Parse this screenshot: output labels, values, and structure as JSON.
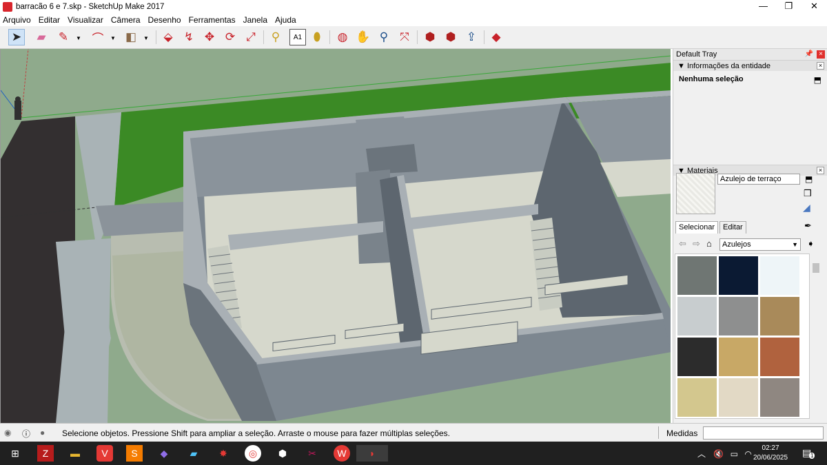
{
  "window": {
    "title": "barracão 6 e 7.skp - SketchUp Make 2017",
    "minimize": "—",
    "restore": "❐",
    "close": "✕"
  },
  "menu": [
    "Arquivo",
    "Editar",
    "Visualizar",
    "Câmera",
    "Desenho",
    "Ferramentas",
    "Janela",
    "Ajuda"
  ],
  "toolbar": {
    "tools": [
      {
        "name": "select-tool",
        "glyph": "➤",
        "selected": true
      },
      {
        "name": "eraser-tool",
        "glyph": "▰"
      },
      {
        "name": "pencil-tool",
        "glyph": "✎"
      },
      {
        "name": "arc-tool",
        "glyph": "⌒"
      },
      {
        "name": "shapes-tool",
        "glyph": "◧"
      },
      {
        "name": "push-pull-tool",
        "glyph": "⬙"
      },
      {
        "name": "follow-me-tool",
        "glyph": "↯"
      },
      {
        "name": "move-tool",
        "glyph": "✥"
      },
      {
        "name": "rotate-tool",
        "glyph": "⟳"
      },
      {
        "name": "scale-tool",
        "glyph": "⤢"
      },
      {
        "name": "tape-measure-tool",
        "glyph": "⚲"
      },
      {
        "name": "text-tool",
        "glyph": "A1"
      },
      {
        "name": "paint-bucket-tool",
        "glyph": "⬮"
      },
      {
        "name": "orbit-tool",
        "glyph": "◍"
      },
      {
        "name": "pan-tool",
        "glyph": "✋"
      },
      {
        "name": "zoom-tool",
        "glyph": "⚲"
      },
      {
        "name": "zoom-extents-tool",
        "glyph": "⤧"
      },
      {
        "name": "warehouse-tool",
        "glyph": "⬢"
      },
      {
        "name": "extension-warehouse-tool",
        "glyph": "⬢"
      },
      {
        "name": "share-model-tool",
        "glyph": "⇪"
      },
      {
        "name": "extension-manager-tool",
        "glyph": "◆"
      }
    ],
    "colors": {
      "red": "#c8232b",
      "green": "#2f8a3a"
    }
  },
  "tray": {
    "title": "Default Tray",
    "entity_panel": {
      "title": "Informações da entidade",
      "selection": "Nenhuma seleção"
    },
    "materials_panel": {
      "title": "Materiais",
      "material_name": "Azulejo de terraço",
      "tabs": [
        "Selecionar",
        "Editar"
      ],
      "collection": "Azulejos",
      "swatch_colors": [
        "#6f7673",
        "#0b1a33",
        "#eef5f8",
        "#c8cdcf",
        "#8e8f8f",
        "#a98a5a",
        "#2c2c2c",
        "#c8a866",
        "#b0623e",
        "#d3c78e",
        "#e2d9c5",
        "#8f8781"
      ]
    }
  },
  "status": {
    "message": "Selecione objetos. Pressione Shift para ampliar a seleção. Arraste o mouse para fazer múltiplas seleções.",
    "measures_label": "Medidas",
    "measures_value": ""
  },
  "taskbar": {
    "time": "02:27",
    "date": "20/06/2025",
    "notification_count": "1"
  }
}
